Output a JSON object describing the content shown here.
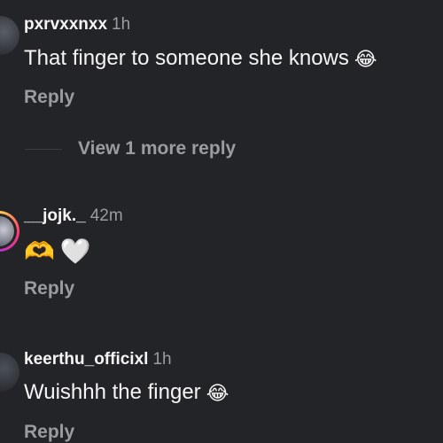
{
  "comments": [
    {
      "username": "pxrvxxnxx",
      "time": "1h",
      "text": "That finger to someone she knows",
      "emoji": "😂",
      "reply_label": "Reply"
    },
    {
      "username": "__jojk._",
      "time": "42m",
      "emoji_1": "🫶",
      "emoji_2": "🤍",
      "reply_label": "Reply"
    },
    {
      "username": "keerthu_officixl",
      "time": "1h",
      "text": "Wuishhh the finger",
      "emoji": "😂",
      "reply_label": "Reply"
    }
  ],
  "view_more_label": "View 1 more reply"
}
